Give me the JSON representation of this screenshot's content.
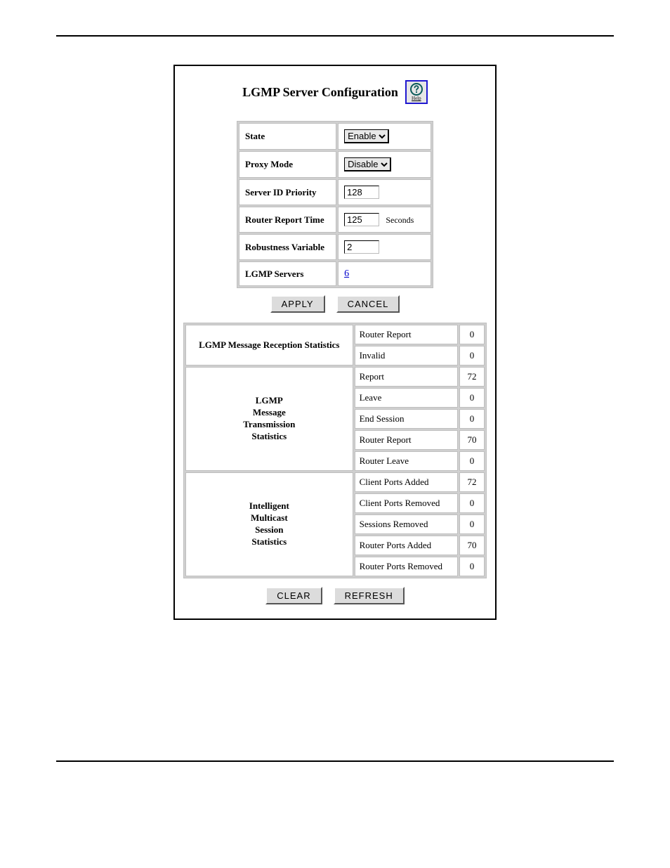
{
  "header": {
    "title": "LGMP Server Configuration",
    "help_label": "Help"
  },
  "config": {
    "rows": {
      "state": {
        "label": "State",
        "value": "Enable"
      },
      "proxy": {
        "label": "Proxy Mode",
        "value": "Disable"
      },
      "priority": {
        "label": "Server ID Priority",
        "value": "128"
      },
      "rrtime": {
        "label": "Router Report Time",
        "value": "125",
        "suffix": "Seconds"
      },
      "robust": {
        "label": "Robustness Variable",
        "value": "2"
      },
      "servers": {
        "label": "LGMP Servers",
        "value": "6"
      }
    },
    "buttons": {
      "apply": "APPLY",
      "cancel": "CANCEL"
    }
  },
  "stats": {
    "rx": {
      "title": "LGMP Message Reception Statistics",
      "rows": [
        {
          "label": "Router Report",
          "value": "0"
        },
        {
          "label": "Invalid",
          "value": "0"
        }
      ]
    },
    "tx": {
      "title_l1": "LGMP",
      "title_l2": "Message",
      "title_l3": "Transmission",
      "title_l4": "Statistics",
      "rows": [
        {
          "label": "Report",
          "value": "72"
        },
        {
          "label": "Leave",
          "value": "0"
        },
        {
          "label": "End Session",
          "value": "0"
        },
        {
          "label": "Router Report",
          "value": "70"
        },
        {
          "label": "Router Leave",
          "value": "0"
        }
      ]
    },
    "im": {
      "title_l1": "Intelligent",
      "title_l2": "Multicast",
      "title_l3": "Session",
      "title_l4": "Statistics",
      "rows": [
        {
          "label": "Client Ports Added",
          "value": "72"
        },
        {
          "label": "Client Ports Removed",
          "value": "0"
        },
        {
          "label": "Sessions Removed",
          "value": "0"
        },
        {
          "label": "Router Ports Added",
          "value": "70"
        },
        {
          "label": "Router Ports Removed",
          "value": "0"
        }
      ]
    },
    "buttons": {
      "clear": "CLEAR",
      "refresh": "REFRESH"
    }
  }
}
